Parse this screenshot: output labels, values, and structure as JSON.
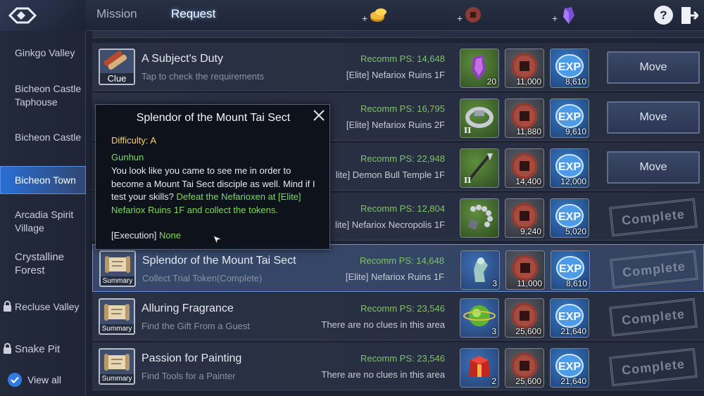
{
  "header": {
    "tabs": [
      {
        "label": "Mission",
        "active": false
      },
      {
        "label": "Request",
        "active": true
      }
    ],
    "currencies": [
      {
        "plus": "+",
        "icon": "gold-coins-icon"
      },
      {
        "plus": "+",
        "icon": "copper-coin-icon"
      },
      {
        "plus": "+",
        "icon": "purple-crystal-icon"
      }
    ],
    "help_label": "?",
    "exit_icon": "exit-door-icon"
  },
  "sidebar": {
    "items": [
      {
        "label": "Ginkgo Valley",
        "active": false,
        "locked": false
      },
      {
        "label": "Bicheon Castle Taphouse",
        "active": false,
        "locked": false
      },
      {
        "label": "Bicheon Castle",
        "active": false,
        "locked": false
      },
      {
        "label": "Bicheon Town",
        "active": true,
        "locked": false
      },
      {
        "label": "Arcadia Spirit Village",
        "active": false,
        "locked": false
      },
      {
        "label": "Crystalline Forest",
        "active": false,
        "locked": false
      },
      {
        "label": "Recluse Valley",
        "active": false,
        "locked": true
      },
      {
        "label": "Snake Pit",
        "active": false,
        "locked": true
      }
    ],
    "view_all_label": "View all"
  },
  "requests": [
    {
      "title": "A Subject's Duty",
      "subtitle": "Tap to check the requirements",
      "badge": "Clue",
      "ps": "Recomm PS: 14,648",
      "location": "[Elite] Nefariox Ruins 1F",
      "item": {
        "icon": "purple-crystal-pendant-icon",
        "qty": "20",
        "tier": ""
      },
      "coin": "11,000",
      "exp": "8,610",
      "action": "Move",
      "status": "move"
    },
    {
      "title": "",
      "subtitle": "",
      "badge": "",
      "ps": "Recomm PS: 16,795",
      "location": "[Elite] Nefariox Ruins 2F",
      "item": {
        "icon": "bracelet-icon",
        "qty": "",
        "tier": "II"
      },
      "coin": "11,880",
      "exp": "9,610",
      "action": "Move",
      "status": "move"
    },
    {
      "title": "",
      "subtitle": "",
      "badge": "",
      "ps": "Recomm PS: 22,948",
      "location": "lite] Demon Bull Temple 1F",
      "item": {
        "icon": "spear-icon",
        "qty": "",
        "tier": "II"
      },
      "coin": "14,400",
      "exp": "12,000",
      "action": "Move",
      "status": "move"
    },
    {
      "title": "",
      "subtitle": "",
      "badge": "",
      "ps": "Recomm PS: 12,804",
      "location": "lite] Nefariox Necropolis 1F",
      "item": {
        "icon": "prayer-beads-icon",
        "qty": "",
        "tier": ""
      },
      "coin": "9,240",
      "exp": "5,020",
      "action": "Complete",
      "status": "complete"
    },
    {
      "title": "Splendor of the Mount Tai Sect",
      "subtitle": "Collect Trial Token(Complete)",
      "badge": "Summary",
      "ps": "Recomm PS: 14,648",
      "location": "[Elite] Nefariox Ruins 1F",
      "item": {
        "icon": "jade-figure-icon",
        "qty": "3",
        "tier": ""
      },
      "coin": "11,000",
      "exp": "8,610",
      "action": "Complete",
      "status": "complete"
    },
    {
      "title": "Alluring Fragrance",
      "subtitle": "Find the Gift From a Guest",
      "badge": "Summary",
      "ps": "Recomm PS: 23,546",
      "location": "There are no clues in this area",
      "item": {
        "icon": "green-orb-icon",
        "qty": "3",
        "tier": ""
      },
      "coin": "25,600",
      "exp": "21,640",
      "action": "Complete",
      "status": "complete"
    },
    {
      "title": "Passion for Painting",
      "subtitle": "Find Tools for a Painter",
      "badge": "Summary",
      "ps": "Recomm PS: 23,546",
      "location": "There are no clues in this area",
      "item": {
        "icon": "red-chest-icon",
        "qty": "2",
        "tier": ""
      },
      "coin": "25,600",
      "exp": "21,640",
      "action": "Complete",
      "status": "complete"
    }
  ],
  "popup": {
    "title": "Splendor of the Mount Tai Sect",
    "difficulty": "Difficulty: A",
    "npc": "Gunhun",
    "text_plain": "You look like you came to see me in order to become a Mount Tai Sect disciple as well. Mind if I test your skills? ",
    "text_highlight": "Defeat the Nefarioxen at [Elite] Nefariox Ruins 1F and collect the tokens.",
    "exec_label": "[Execution] ",
    "exec_value": "None"
  },
  "exp_label": "EXP",
  "colors": {
    "accent": "#2f7be0",
    "recomm_green": "#80c26a",
    "highlight_green": "#7ddc57",
    "difficulty_yellow": "#f4d35e"
  }
}
